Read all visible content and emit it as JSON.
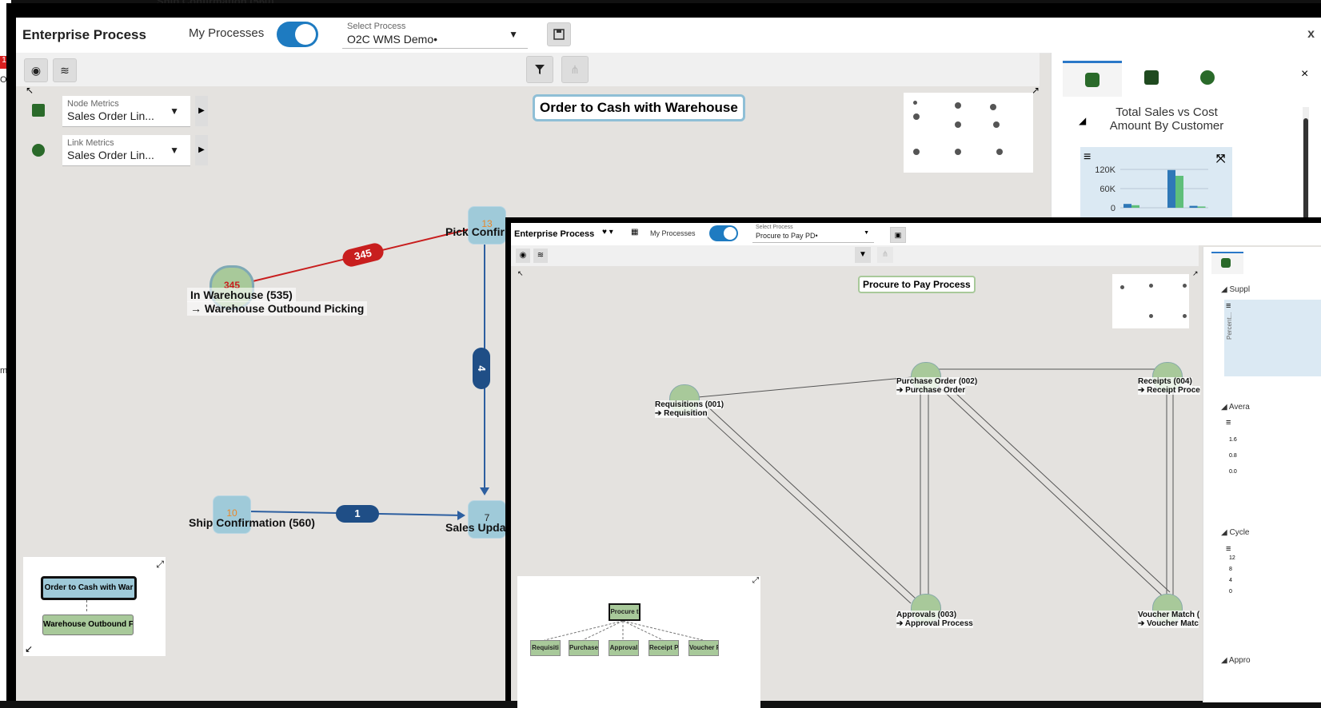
{
  "back_window": {
    "title": "Enterprise Process",
    "my_processes_label": "My Processes",
    "select_process": {
      "caption": "Select Process",
      "value": "O2C WMS Demo•"
    },
    "behind_text": "Ship Confirmation (560)",
    "close_label": "x",
    "node_metrics": {
      "caption": "Node Metrics",
      "value": "Sales Order Lin..."
    },
    "link_metrics": {
      "caption": "Link Metrics",
      "value": "Sales Order Lin..."
    },
    "diagram_title": "Order to Cash with Warehouse",
    "nodes": {
      "in_warehouse": {
        "count": "345",
        "label_line1": "In Warehouse (535)",
        "label_line2": "→ Warehouse Outbound Picking"
      },
      "pick_confirm": {
        "count": "13",
        "label": "Pick Confir"
      },
      "ship_confirmation": {
        "count": "10",
        "label": "Ship Confirmation (560)"
      },
      "sales_update": {
        "count": "7",
        "label": "Sales Upda"
      }
    },
    "links": {
      "warehouse_to_pick": "345",
      "pick_to_sales": "4",
      "ship_to_sales": "1"
    },
    "panel": {
      "close_label": "×",
      "chart_title_line1": "Total Sales vs Cost",
      "chart_title_line2": "Amount By Customer"
    },
    "minimap": {
      "top_box": "Order to Cash with War",
      "bottom_box": "Warehouse Outbound F"
    },
    "left_edge": {
      "badge": "1",
      "text1": "Or",
      "text2": "m"
    }
  },
  "chart_data": {
    "type": "bar",
    "title": "Total Sales vs Cost Amount By Customer",
    "ytick_labels": [
      "120K",
      "60K",
      "0"
    ],
    "ylim": [
      0,
      140000
    ],
    "categories": [
      "",
      "",
      "",
      ""
    ],
    "series": [
      {
        "color": "#2f78b7",
        "values": [
          12000,
          0,
          118000,
          6000
        ]
      },
      {
        "color": "#5fbf7a",
        "values": [
          8000,
          0,
          100000,
          4000
        ]
      }
    ]
  },
  "front_window": {
    "title": "Enterprise Process",
    "my_processes_label": "My Processes",
    "select_process": {
      "caption": "Select Process",
      "value": "Procure to Pay PD•"
    },
    "diagram_title": "Procure to Pay Process",
    "nodes": {
      "requisitions": {
        "line1": "Requisitions (001)",
        "line2": "➔ Requisition"
      },
      "purchase_order": {
        "line1": "Purchase Order (002)",
        "line2": "➔ Purchase Order"
      },
      "receipts": {
        "line1": "Receipts (004)",
        "line2": "➔ Receipt Proce"
      },
      "approvals": {
        "line1": "Approvals (003)",
        "line2": "➔ Approval Process"
      },
      "voucher": {
        "line1": "Voucher Match (",
        "line2": "➔ Voucher Matc"
      }
    },
    "panel": {
      "section1": "◢ Suppl",
      "axis1": "Percent...",
      "section2": "◢ Avera",
      "ticks2": [
        "1.6",
        "0.8",
        "0.0"
      ],
      "section3": "◢ Cycle",
      "ticks3": [
        "12",
        "8",
        "4",
        "0"
      ],
      "section4": "◢ Appro"
    },
    "minimap": {
      "root": "Procure t",
      "children": [
        "Requisiti",
        "Purchase",
        "Approval",
        "Receipt P",
        "Voucher F"
      ]
    }
  }
}
